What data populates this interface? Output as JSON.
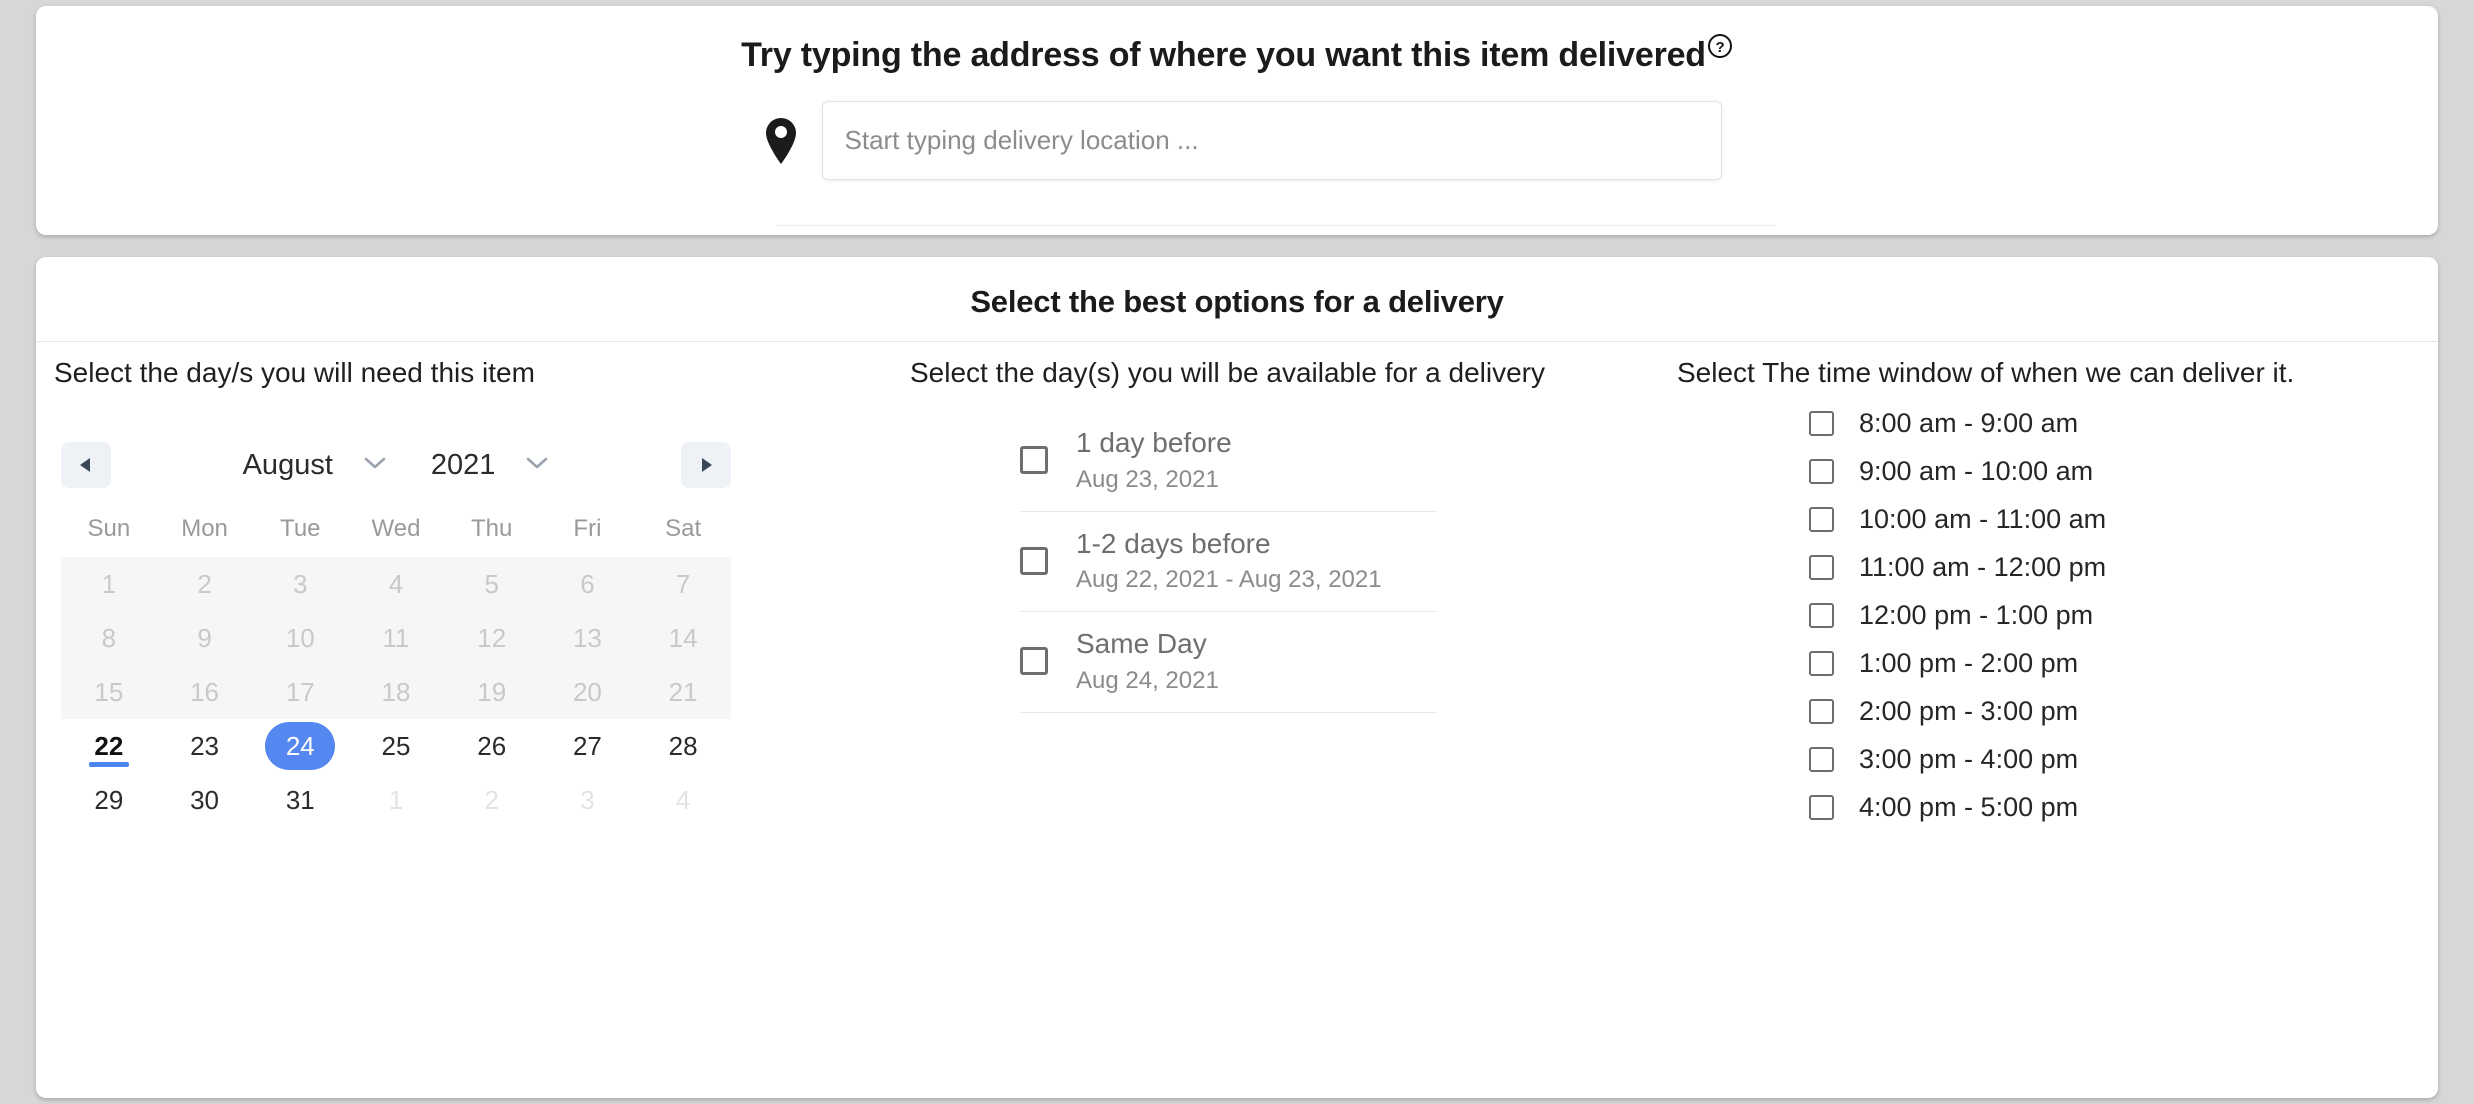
{
  "address_card": {
    "title": "Try typing the address of where you want this item delivered",
    "help_icon": "question-circle-icon",
    "pin_icon": "map-pin-icon",
    "input_placeholder": "Start typing delivery location ...",
    "input_value": ""
  },
  "delivery_card": {
    "title": "Select the best options for a delivery",
    "columns": {
      "days_needed": {
        "heading": "Select the day/s you will need this item",
        "calendar": {
          "prev_icon": "triangle-left-icon",
          "next_icon": "triangle-right-icon",
          "month": "August",
          "year": "2021",
          "month_chevron_icon": "chevron-down-icon",
          "year_chevron_icon": "chevron-down-icon",
          "weekdays": [
            "Sun",
            "Mon",
            "Tue",
            "Wed",
            "Thu",
            "Fri",
            "Sat"
          ],
          "selected_day": 24,
          "today": 22,
          "weeks": [
            [
              {
                "d": 1,
                "state": "disabled"
              },
              {
                "d": 2,
                "state": "disabled"
              },
              {
                "d": 3,
                "state": "disabled"
              },
              {
                "d": 4,
                "state": "disabled"
              },
              {
                "d": 5,
                "state": "disabled"
              },
              {
                "d": 6,
                "state": "disabled"
              },
              {
                "d": 7,
                "state": "disabled"
              }
            ],
            [
              {
                "d": 8,
                "state": "disabled"
              },
              {
                "d": 9,
                "state": "disabled"
              },
              {
                "d": 10,
                "state": "disabled"
              },
              {
                "d": 11,
                "state": "disabled"
              },
              {
                "d": 12,
                "state": "disabled"
              },
              {
                "d": 13,
                "state": "disabled"
              },
              {
                "d": 14,
                "state": "disabled"
              }
            ],
            [
              {
                "d": 15,
                "state": "disabled"
              },
              {
                "d": 16,
                "state": "disabled"
              },
              {
                "d": 17,
                "state": "disabled"
              },
              {
                "d": 18,
                "state": "disabled"
              },
              {
                "d": 19,
                "state": "disabled"
              },
              {
                "d": 20,
                "state": "disabled"
              },
              {
                "d": 21,
                "state": "disabled"
              }
            ],
            [
              {
                "d": 22,
                "state": "today"
              },
              {
                "d": 23,
                "state": "normal"
              },
              {
                "d": 24,
                "state": "selected"
              },
              {
                "d": 25,
                "state": "normal"
              },
              {
                "d": 26,
                "state": "normal"
              },
              {
                "d": 27,
                "state": "normal"
              },
              {
                "d": 28,
                "state": "normal"
              }
            ],
            [
              {
                "d": 29,
                "state": "normal"
              },
              {
                "d": 30,
                "state": "normal"
              },
              {
                "d": 31,
                "state": "normal"
              },
              {
                "d": 1,
                "state": "othermonth"
              },
              {
                "d": 2,
                "state": "othermonth"
              },
              {
                "d": 3,
                "state": "othermonth"
              },
              {
                "d": 4,
                "state": "othermonth"
              }
            ]
          ]
        }
      },
      "availability": {
        "heading": "Select the day(s) you will be available for a delivery",
        "options": [
          {
            "title": "1 day before",
            "dates": "Aug 23, 2021",
            "checked": false
          },
          {
            "title": "1-2 days before",
            "dates": "Aug 22, 2021 - Aug 23, 2021",
            "checked": false
          },
          {
            "title": "Same Day",
            "dates": "Aug 24, 2021",
            "checked": false
          }
        ]
      },
      "time_windows": {
        "heading": "Select The time window of when we can deliver it.",
        "options": [
          {
            "label": "8:00 am - 9:00 am",
            "checked": false
          },
          {
            "label": "9:00 am - 10:00 am",
            "checked": false
          },
          {
            "label": "10:00 am - 11:00 am",
            "checked": false
          },
          {
            "label": "11:00 am - 12:00 pm",
            "checked": false
          },
          {
            "label": "12:00 pm - 1:00 pm",
            "checked": false
          },
          {
            "label": "1:00 pm - 2:00 pm",
            "checked": false
          },
          {
            "label": "2:00 pm - 3:00 pm",
            "checked": false
          },
          {
            "label": "3:00 pm - 4:00 pm",
            "checked": false
          },
          {
            "label": "4:00 pm - 5:00 pm",
            "checked": false
          }
        ]
      }
    }
  },
  "colors": {
    "accent_blue": "#5587f0",
    "today_underline": "#4a86f0",
    "page_background": "#d7d7d7",
    "card_background": "#ffffff",
    "disabled_cell": "#f6f6f6"
  }
}
